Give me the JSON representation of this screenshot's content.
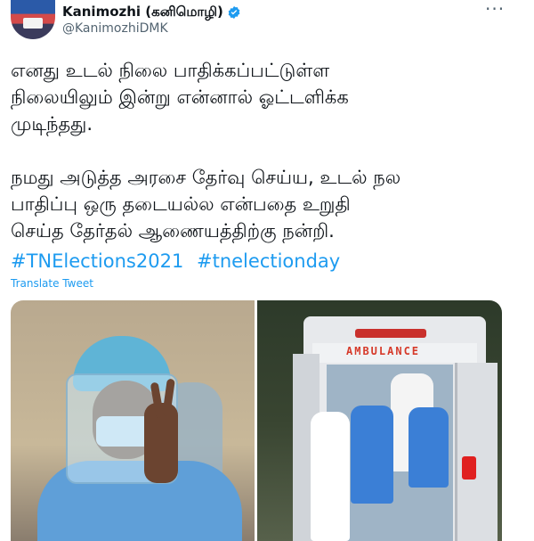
{
  "author": {
    "display_name": "Kanimozhi (கனிமொழி)",
    "handle": "@KanimozhiDMK",
    "verified": true,
    "avatar_icon": "profile-avatar"
  },
  "menu_icon": "more-options-icon",
  "menu_glyph": "···",
  "tweet": {
    "text": "எனது உடல் நிலை பாதிக்கப்பட்டுள்ள\nநிலையிலும் இன்று என்னால் ஓட்டளிக்க\nமுடிந்தது.\n\nநமது அடுத்த அரசை தேர்வு செய்ய, உடல் நல\nபாதிப்பு ஒரு தடையல்ல என்பதை உறுதி\nசெய்த தேர்தல் ஆணையத்திற்கு நன்றி.",
    "hashtags": [
      "#TNElections2021",
      "#tnelectionday"
    ],
    "translate_label": "Translate Tweet"
  },
  "media": {
    "image_right_label": "AMBULANCE"
  },
  "colors": {
    "link": "#1d9bf0",
    "verified_badge": "#1d9bf0",
    "secondary_text": "#536471"
  }
}
